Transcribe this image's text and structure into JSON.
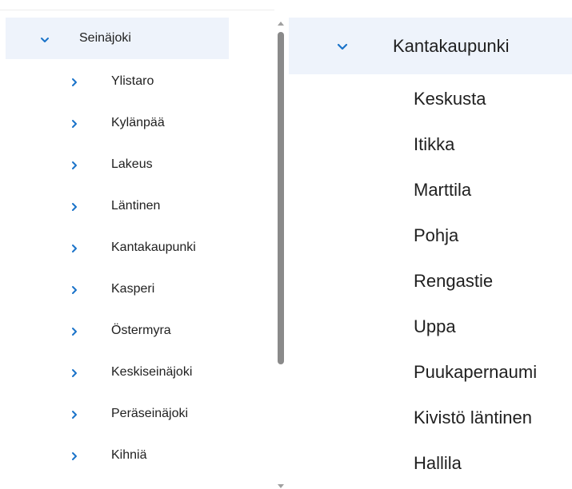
{
  "left_tree": {
    "root": {
      "label": "Seinäjoki",
      "expanded": true,
      "icon": "chevron-down-icon"
    },
    "children": [
      {
        "label": "Ylistaro",
        "icon": "chevron-right-icon"
      },
      {
        "label": "Kylänpää",
        "icon": "chevron-right-icon"
      },
      {
        "label": "Lakeus",
        "icon": "chevron-right-icon"
      },
      {
        "label": "Läntinen",
        "icon": "chevron-right-icon"
      },
      {
        "label": "Kantakaupunki",
        "icon": "chevron-right-icon"
      },
      {
        "label": "Kasperi",
        "icon": "chevron-right-icon"
      },
      {
        "label": "Östermyra",
        "icon": "chevron-right-icon"
      },
      {
        "label": "Keskiseinäjoki",
        "icon": "chevron-right-icon"
      },
      {
        "label": "Peräseinäjoki",
        "icon": "chevron-right-icon"
      },
      {
        "label": "Kihniä",
        "icon": "chevron-right-icon"
      }
    ]
  },
  "right_tree": {
    "root": {
      "label": "Kantakaupunki",
      "expanded": true,
      "icon": "chevron-down-icon"
    },
    "children": [
      {
        "label": "Keskusta"
      },
      {
        "label": "Itikka"
      },
      {
        "label": "Marttila"
      },
      {
        "label": "Pohja"
      },
      {
        "label": "Rengastie"
      },
      {
        "label": "Uppa"
      },
      {
        "label": "Puukapernaumi"
      },
      {
        "label": "Kivistö läntinen"
      },
      {
        "label": "Hallila"
      }
    ]
  },
  "colors": {
    "accent": "#1a73c9",
    "selected_bg": "#eef3fb",
    "text": "#1f1f1f",
    "scroll_thumb": "#8a8a8a"
  }
}
